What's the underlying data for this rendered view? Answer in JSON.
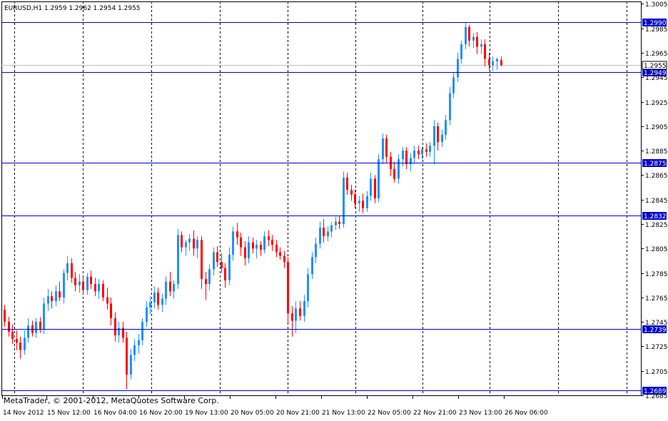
{
  "header": {
    "symbol_info": "EURUSD,H1  1.2959 1.2962 1.2954 1.2955"
  },
  "footer": {
    "copyright": "MetaTrader, © 2001-2012, MetaQuotes Software Corp."
  },
  "colors": {
    "bull": "#1e90ff",
    "bear": "#ff0000",
    "hline": "#0000cd",
    "grid": "#000000",
    "price_line": "#c0c0c0",
    "frame": "#000000"
  },
  "chart_data": {
    "type": "candlestick",
    "title": "EURUSD,H1",
    "ohlc_header": {
      "open": 1.2959,
      "high": 1.2962,
      "low": 1.2954,
      "close": 1.2955
    },
    "ylim": [
      1.2685,
      1.3007
    ],
    "y_ticks": [
      "1.3005",
      "1.2985",
      "1.2965",
      "1.2945",
      "1.2925",
      "1.2905",
      "1.2885",
      "1.2865",
      "1.2845",
      "1.2825",
      "1.2805",
      "1.2785",
      "1.2765",
      "1.2745",
      "1.2725",
      "1.2705",
      "1.2685"
    ],
    "x_ticks": [
      "14 Nov 2012",
      "15 Nov 12:00",
      "16 Nov 04:00",
      "16 Nov 20:00",
      "19 Nov 13:00",
      "20 Nov 05:00",
      "20 Nov 21:00",
      "21 Nov 13:00",
      "22 Nov 05:00",
      "22 Nov 21:00",
      "23 Nov 13:00",
      "26 Nov 06:00"
    ],
    "grid": true,
    "horizontal_lines": [
      {
        "label": "1.2990",
        "value": 1.299
      },
      {
        "label": "1.2949",
        "value": 1.2949
      },
      {
        "label": "1.2875",
        "value": 1.2875
      },
      {
        "label": "1.2832",
        "value": 1.2832
      },
      {
        "label": "1.2739",
        "value": 1.2739
      },
      {
        "label": "1.2689",
        "value": 1.2689
      }
    ],
    "current_price": {
      "label": "1.2955",
      "value": 1.2955
    },
    "candles": [
      [
        1.2755,
        1.2759,
        1.2741,
        1.2745
      ],
      [
        1.2745,
        1.2749,
        1.2733,
        1.2737
      ],
      [
        1.2737,
        1.2743,
        1.2727,
        1.2731
      ],
      [
        1.2731,
        1.2738,
        1.2722,
        1.2728
      ],
      [
        1.2728,
        1.2733,
        1.2715,
        1.2722
      ],
      [
        1.2722,
        1.2738,
        1.2718,
        1.2732
      ],
      [
        1.2732,
        1.2748,
        1.2728,
        1.2742
      ],
      [
        1.2742,
        1.2746,
        1.2733,
        1.2736
      ],
      [
        1.2736,
        1.2748,
        1.2732,
        1.2745
      ],
      [
        1.2745,
        1.2749,
        1.2736,
        1.2739
      ],
      [
        1.2739,
        1.2765,
        1.2735,
        1.276
      ],
      [
        1.276,
        1.2772,
        1.2754,
        1.2766
      ],
      [
        1.2766,
        1.277,
        1.2756,
        1.2762
      ],
      [
        1.2762,
        1.2775,
        1.2758,
        1.277
      ],
      [
        1.277,
        1.2778,
        1.2762,
        1.2765
      ],
      [
        1.2765,
        1.2788,
        1.276,
        1.2785
      ],
      [
        1.2785,
        1.2799,
        1.2779,
        1.2793
      ],
      [
        1.2793,
        1.2797,
        1.2777,
        1.2781
      ],
      [
        1.2781,
        1.2786,
        1.277,
        1.2775
      ],
      [
        1.2775,
        1.2784,
        1.2769,
        1.2778
      ],
      [
        1.2778,
        1.2782,
        1.2768,
        1.2771
      ],
      [
        1.2771,
        1.2785,
        1.2767,
        1.2782
      ],
      [
        1.2782,
        1.2787,
        1.2772,
        1.2776
      ],
      [
        1.2776,
        1.2781,
        1.2766,
        1.277
      ],
      [
        1.277,
        1.278,
        1.2764,
        1.2776
      ],
      [
        1.2776,
        1.2779,
        1.2762,
        1.2765
      ],
      [
        1.2765,
        1.2773,
        1.2755,
        1.276
      ],
      [
        1.276,
        1.2765,
        1.2742,
        1.2748
      ],
      [
        1.2748,
        1.2753,
        1.2729,
        1.2734
      ],
      [
        1.2734,
        1.2745,
        1.2728,
        1.274
      ],
      [
        1.274,
        1.2745,
        1.2728,
        1.2732
      ],
      [
        1.2732,
        1.2737,
        1.269,
        1.2702
      ],
      [
        1.2702,
        1.2723,
        1.2698,
        1.2718
      ],
      [
        1.2718,
        1.2731,
        1.2713,
        1.2726
      ],
      [
        1.2726,
        1.2735,
        1.2719,
        1.273
      ],
      [
        1.273,
        1.2748,
        1.2726,
        1.2745
      ],
      [
        1.2745,
        1.2762,
        1.2741,
        1.2757
      ],
      [
        1.2757,
        1.2766,
        1.2751,
        1.2761
      ],
      [
        1.2761,
        1.2774,
        1.2756,
        1.2769
      ],
      [
        1.2769,
        1.2773,
        1.2755,
        1.2759
      ],
      [
        1.2759,
        1.2768,
        1.2753,
        1.2764
      ],
      [
        1.2764,
        1.2782,
        1.2759,
        1.2778
      ],
      [
        1.2778,
        1.2786,
        1.2766,
        1.277
      ],
      [
        1.277,
        1.2779,
        1.2764,
        1.2776
      ],
      [
        1.2776,
        1.2821,
        1.2772,
        1.2816
      ],
      [
        1.2816,
        1.2819,
        1.2802,
        1.2806
      ],
      [
        1.2806,
        1.2812,
        1.2799,
        1.281
      ],
      [
        1.281,
        1.2817,
        1.2803,
        1.2813
      ],
      [
        1.2813,
        1.282,
        1.2799,
        1.2805
      ],
      [
        1.2805,
        1.2815,
        1.2797,
        1.2812
      ],
      [
        1.2812,
        1.2815,
        1.2772,
        1.278
      ],
      [
        1.278,
        1.2786,
        1.2763,
        1.2776
      ],
      [
        1.2776,
        1.2792,
        1.2771,
        1.2788
      ],
      [
        1.2788,
        1.2806,
        1.2783,
        1.2802
      ],
      [
        1.2802,
        1.2807,
        1.279,
        1.2794
      ],
      [
        1.2794,
        1.2801,
        1.2785,
        1.2789
      ],
      [
        1.2789,
        1.2793,
        1.2773,
        1.2779
      ],
      [
        1.2779,
        1.2806,
        1.2775,
        1.28
      ],
      [
        1.28,
        1.2823,
        1.2795,
        1.2819
      ],
      [
        1.2819,
        1.2826,
        1.2808,
        1.2814
      ],
      [
        1.2814,
        1.2818,
        1.2799,
        1.2806
      ],
      [
        1.2806,
        1.2811,
        1.2791,
        1.2797
      ],
      [
        1.2797,
        1.2815,
        1.2793,
        1.281
      ],
      [
        1.281,
        1.2814,
        1.2801,
        1.2805
      ],
      [
        1.2805,
        1.2812,
        1.2797,
        1.2808
      ],
      [
        1.2808,
        1.2811,
        1.2799,
        1.2804
      ],
      [
        1.2804,
        1.2819,
        1.2801,
        1.2815
      ],
      [
        1.2815,
        1.282,
        1.2807,
        1.2812
      ],
      [
        1.2812,
        1.2816,
        1.2803,
        1.2808
      ],
      [
        1.2808,
        1.2812,
        1.2798,
        1.2802
      ],
      [
        1.2802,
        1.2806,
        1.2796,
        1.2799
      ],
      [
        1.2799,
        1.2803,
        1.2789,
        1.2794
      ],
      [
        1.2794,
        1.2798,
        1.2744,
        1.2752
      ],
      [
        1.2752,
        1.2758,
        1.2733,
        1.2746
      ],
      [
        1.2746,
        1.2762,
        1.2736,
        1.2756
      ],
      [
        1.2756,
        1.2762,
        1.2746,
        1.275
      ],
      [
        1.275,
        1.2767,
        1.2745,
        1.2762
      ],
      [
        1.2762,
        1.2789,
        1.2757,
        1.2784
      ],
      [
        1.2784,
        1.2802,
        1.278,
        1.2798
      ],
      [
        1.2798,
        1.2814,
        1.2793,
        1.2809
      ],
      [
        1.2809,
        1.2827,
        1.2805,
        1.2822
      ],
      [
        1.2822,
        1.2829,
        1.281,
        1.2815
      ],
      [
        1.2815,
        1.2823,
        1.2811,
        1.2819
      ],
      [
        1.2819,
        1.2827,
        1.2814,
        1.2824
      ],
      [
        1.2824,
        1.2831,
        1.282,
        1.2827
      ],
      [
        1.2827,
        1.2832,
        1.2821,
        1.2825
      ],
      [
        1.2825,
        1.2868,
        1.2822,
        1.2863
      ],
      [
        1.2863,
        1.2867,
        1.2849,
        1.2853
      ],
      [
        1.2853,
        1.2857,
        1.2844,
        1.2849
      ],
      [
        1.2849,
        1.2853,
        1.2838,
        1.2842
      ],
      [
        1.2842,
        1.2848,
        1.2835,
        1.2844
      ],
      [
        1.2844,
        1.285,
        1.2834,
        1.2838
      ],
      [
        1.2838,
        1.2852,
        1.2835,
        1.2848
      ],
      [
        1.2848,
        1.2867,
        1.2844,
        1.2862
      ],
      [
        1.2862,
        1.2865,
        1.2842,
        1.2846
      ],
      [
        1.2846,
        1.2882,
        1.2843,
        1.2878
      ],
      [
        1.2878,
        1.2899,
        1.2874,
        1.2895
      ],
      [
        1.2895,
        1.2898,
        1.2875,
        1.288
      ],
      [
        1.288,
        1.2884,
        1.2864,
        1.287
      ],
      [
        1.287,
        1.2876,
        1.2859,
        1.2862
      ],
      [
        1.2862,
        1.2882,
        1.2858,
        1.2878
      ],
      [
        1.2878,
        1.2888,
        1.2872,
        1.2885
      ],
      [
        1.2885,
        1.2888,
        1.287,
        1.2874
      ],
      [
        1.2874,
        1.2883,
        1.2868,
        1.2879
      ],
      [
        1.2879,
        1.2889,
        1.2875,
        1.2885
      ],
      [
        1.2885,
        1.2889,
        1.2878,
        1.2882
      ],
      [
        1.2882,
        1.2888,
        1.2878,
        1.2886
      ],
      [
        1.2886,
        1.2891,
        1.288,
        1.2884
      ],
      [
        1.2884,
        1.2892,
        1.288,
        1.2889
      ],
      [
        1.2889,
        1.291,
        1.2874,
        1.2905
      ],
      [
        1.2905,
        1.2908,
        1.2885,
        1.2892
      ],
      [
        1.2892,
        1.2902,
        1.2888,
        1.2898
      ],
      [
        1.2898,
        1.2914,
        1.2894,
        1.291
      ],
      [
        1.291,
        1.2937,
        1.2906,
        1.2932
      ],
      [
        1.2932,
        1.2949,
        1.2928,
        1.2945
      ],
      [
        1.2945,
        1.2965,
        1.2941,
        1.296
      ],
      [
        1.296,
        1.2975,
        1.2956,
        1.2972
      ],
      [
        1.2972,
        1.299,
        1.2968,
        1.2986
      ],
      [
        1.2986,
        1.2988,
        1.297,
        1.2975
      ],
      [
        1.2975,
        1.2981,
        1.2969,
        1.2978
      ],
      [
        1.2978,
        1.2982,
        1.2964,
        1.297
      ],
      [
        1.297,
        1.2976,
        1.2964,
        1.2972
      ],
      [
        1.2972,
        1.2976,
        1.2954,
        1.296
      ],
      [
        1.296,
        1.2965,
        1.2951,
        1.2955
      ],
      [
        1.2955,
        1.2962,
        1.295,
        1.2958
      ],
      [
        1.2958,
        1.2961,
        1.2951,
        1.296
      ],
      [
        1.2959,
        1.2962,
        1.2954,
        1.2955
      ]
    ]
  }
}
